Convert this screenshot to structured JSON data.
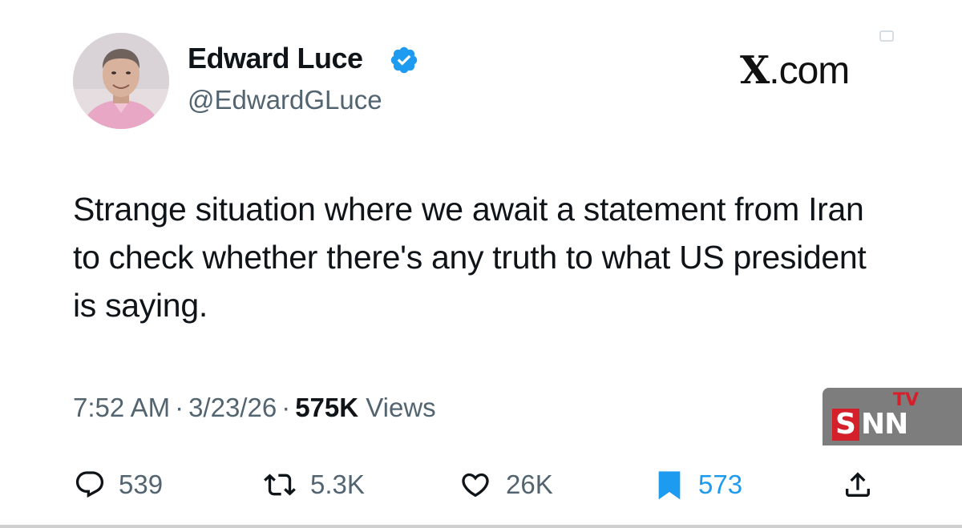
{
  "author": {
    "name": "Edward Luce",
    "handle": "@EdwardGLuce",
    "verified": true,
    "verified_color": "#1d9bf0"
  },
  "site_label": {
    "x": "X",
    "domain": ".com"
  },
  "tweet": {
    "text": "Strange situation where we await a statement from Iran to check whether there's any truth to what US president is saying."
  },
  "meta": {
    "time": "7:52 AM",
    "date": "3/23/26",
    "separator": "·",
    "views_count": "575K",
    "views_label": "Views"
  },
  "actions": {
    "reply": {
      "icon": "reply-icon",
      "count": "539"
    },
    "retweet": {
      "icon": "retweet-icon",
      "count": "5.3K"
    },
    "like": {
      "icon": "heart-icon",
      "count": "26K"
    },
    "bookmark": {
      "icon": "bookmark-icon",
      "count": "573",
      "color": "#1d9bf0"
    },
    "share": {
      "icon": "share-icon"
    }
  },
  "watermark": {
    "s": "S",
    "nn": "NN",
    "tv": "TV",
    "red": "#d4202a"
  },
  "colors": {
    "text": "#0f1419",
    "secondary": "#536471",
    "accent": "#1d9bf0"
  }
}
